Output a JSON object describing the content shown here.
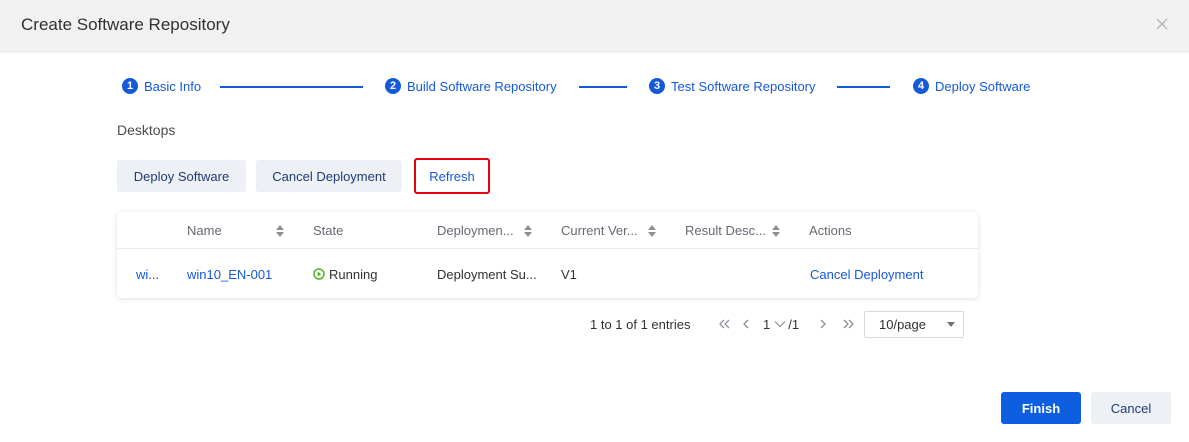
{
  "dialog": {
    "title": "Create Software Repository"
  },
  "steps": [
    {
      "number": "1",
      "label": "Basic Info"
    },
    {
      "number": "2",
      "label": "Build Software Repository"
    },
    {
      "number": "3",
      "label": "Test Software Repository"
    },
    {
      "number": "4",
      "label": "Deploy Software"
    }
  ],
  "section": {
    "label": "Desktops"
  },
  "toolbar": {
    "deploy_label": "Deploy Software",
    "cancel_deploy_label": "Cancel Deployment",
    "refresh_label": "Refresh"
  },
  "table": {
    "columns": {
      "name": "Name",
      "state": "State",
      "deployment": "Deploymen...",
      "current_version": "Current Ver...",
      "result_description": "Result Desc...",
      "actions": "Actions"
    },
    "rows": [
      {
        "id": "wi...",
        "name": "win10_EN-001",
        "state": "Running",
        "deployment": "Deployment Su...",
        "current_version": "V1",
        "result_description": "",
        "action": "Cancel Deployment"
      }
    ]
  },
  "pagination": {
    "summary": "1 to 1 of 1 entries",
    "current_page": "1",
    "total_pages": "/1",
    "page_size": "10/page"
  },
  "footer": {
    "finish_label": "Finish",
    "cancel_label": "Cancel"
  },
  "colors": {
    "primary": "#1459d8",
    "finish_button": "#0d5fe0",
    "highlight_border": "#e60012",
    "running_status": "#52b426",
    "header_bg": "#f1f1f1"
  },
  "icons": {
    "close": "close-icon",
    "sort": "sort-icon",
    "running": "running-status-icon",
    "first_page": "first-page-icon",
    "prev_page": "prev-page-icon",
    "next_page": "next-page-icon",
    "last_page": "last-page-icon",
    "page_dropdown": "chevron-down-icon"
  }
}
